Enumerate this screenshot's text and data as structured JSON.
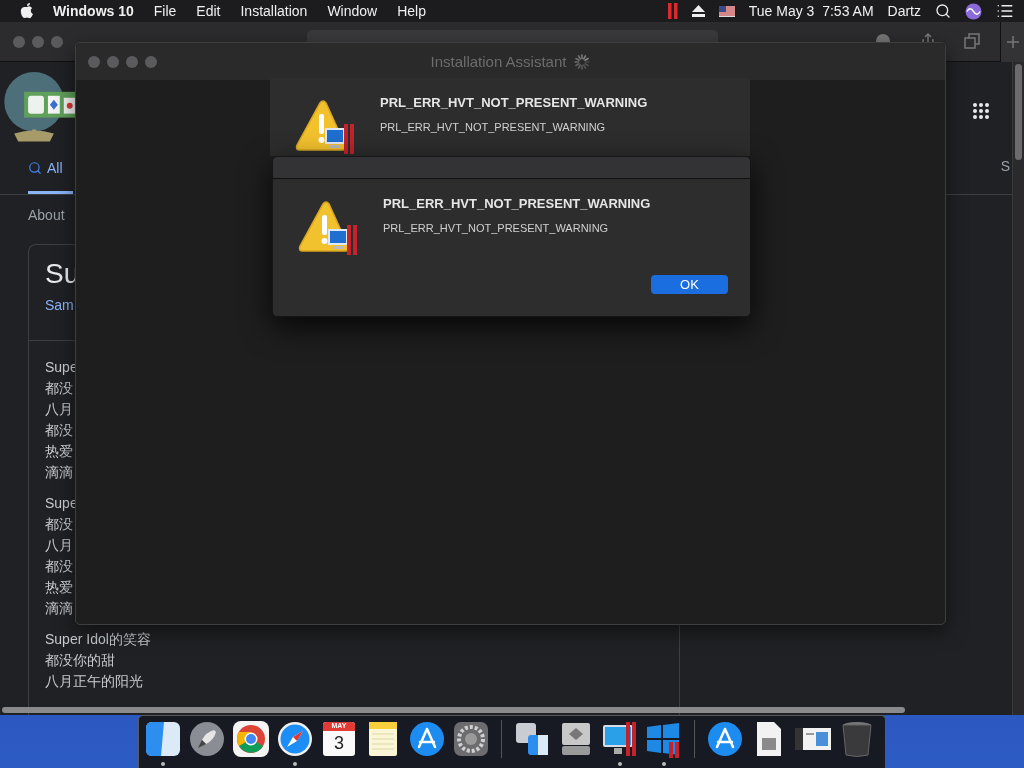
{
  "menu_bar": {
    "app_name": "Windows 10",
    "menus": [
      "File",
      "Edit",
      "Installation",
      "Window",
      "Help"
    ],
    "clock": "Tue May 3  7:53 AM",
    "user": "Dartz"
  },
  "browser": {
    "tab": {
      "label": "All",
      "selected": true
    },
    "right_tab": "S",
    "about": "About",
    "result_title": "Su",
    "result_link": "Sam",
    "verses": [
      [
        "Supe",
        "都没",
        "八月",
        "都没",
        "热爱",
        "滴滴"
      ],
      [
        "Supe",
        "都没",
        "八月",
        "都没",
        "热爱",
        "滴滴"
      ],
      [
        "Super Idol的笑容",
        "都没你的甜",
        "八月正午的阳光"
      ]
    ]
  },
  "installer": {
    "title": "Installation Assistant",
    "alerts": [
      {
        "title": "PRL_ERR_HVT_NOT_PRESENT_WARNING",
        "message": "PRL_ERR_HVT_NOT_PRESENT_WARNING"
      },
      {
        "title": "PRL_ERR_HVT_NOT_PRESENT_WARNING",
        "message": "PRL_ERR_HVT_NOT_PRESENT_WARNING",
        "button": "OK"
      }
    ]
  },
  "dock": {
    "groups": [
      [
        {
          "kind": "finder",
          "running": true
        },
        {
          "kind": "rocket",
          "running": false
        },
        {
          "kind": "chrome",
          "running": false
        },
        {
          "kind": "compass",
          "running": true
        },
        {
          "kind": "calendar",
          "running": false,
          "month": "MAY",
          "day": "3"
        },
        {
          "kind": "notes",
          "running": false
        },
        {
          "kind": "store",
          "running": false
        },
        {
          "kind": "gear",
          "running": false
        }
      ],
      [
        {
          "kind": "migrate",
          "running": false
        },
        {
          "kind": "disk",
          "running": false
        },
        {
          "kind": "monitor",
          "running": true
        },
        {
          "kind": "panes",
          "running": true
        }
      ],
      [
        {
          "kind": "store",
          "running": false
        },
        {
          "kind": "document",
          "running": false
        },
        {
          "kind": "box",
          "running": false
        },
        {
          "kind": "trash",
          "running": false
        }
      ]
    ]
  }
}
